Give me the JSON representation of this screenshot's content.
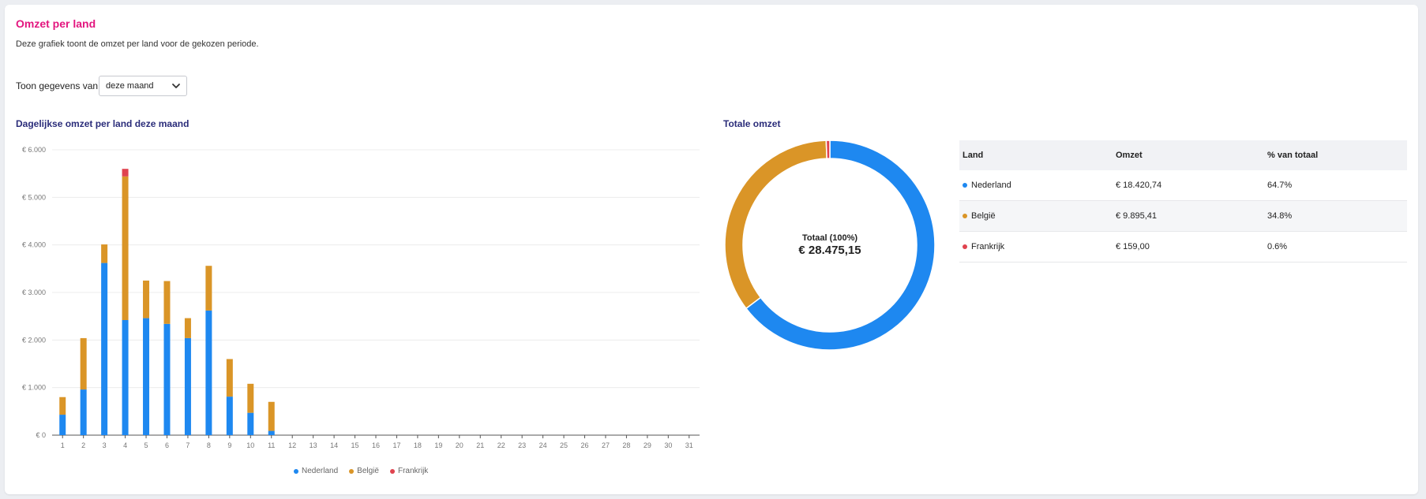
{
  "card": {
    "title": "Omzet per land",
    "description": "Deze grafiek toont de omzet per land voor de gekozen periode.",
    "filter_label": "Toon gegevens van:",
    "filter_value": "deze maand"
  },
  "bar_section_title": "Dagelijkse omzet per land deze maand",
  "donut_section_title": "Totale omzet",
  "donut": {
    "center_label": "Totaal (100%)",
    "center_value": "€ 28.475,15"
  },
  "table": {
    "headers": [
      "Land",
      "Omzet",
      "% van totaal"
    ],
    "rows": [
      {
        "country": "Nederland",
        "amount": "€ 18.420,74",
        "percent": "64.7%",
        "color": "#1e88f0"
      },
      {
        "country": "België",
        "amount": "€ 9.895,41",
        "percent": "34.8%",
        "color": "#da9527"
      },
      {
        "country": "Frankrijk",
        "amount": "€ 159,00",
        "percent": "0.6%",
        "color": "#e0434f"
      }
    ]
  },
  "colors": {
    "nederland": "#1e88f0",
    "belgie": "#da9527",
    "frankrijk": "#e0434f",
    "title": "#e3167f",
    "section_title": "#2b2d7a"
  },
  "chart_data": [
    {
      "type": "bar",
      "stacked": true,
      "title": "Dagelijkse omzet per land deze maand",
      "categories": [
        "1",
        "2",
        "3",
        "4",
        "5",
        "6",
        "7",
        "8",
        "9",
        "10",
        "11",
        "12",
        "13",
        "14",
        "15",
        "16",
        "17",
        "18",
        "19",
        "20",
        "21",
        "22",
        "23",
        "24",
        "25",
        "26",
        "27",
        "28",
        "29",
        "30",
        "31"
      ],
      "y_ticks": [
        "€ 0",
        "€ 1.000",
        "€ 2.000",
        "€ 3.000",
        "€ 4.000",
        "€ 5.000",
        "€ 6.000"
      ],
      "ylim": [
        0,
        6000
      ],
      "grid": true,
      "legend_position": "bottom",
      "series": [
        {
          "name": "Nederland",
          "color": "#1e88f0",
          "values": [
            430,
            960,
            3620,
            2420,
            2460,
            2340,
            2040,
            2620,
            810,
            470,
            90,
            0,
            0,
            0,
            0,
            0,
            0,
            0,
            0,
            0,
            0,
            0,
            0,
            0,
            0,
            0,
            0,
            0,
            0,
            0,
            0
          ]
        },
        {
          "name": "België",
          "color": "#da9527",
          "values": [
            370,
            1080,
            390,
            3020,
            790,
            900,
            420,
            940,
            790,
            610,
            610,
            0,
            0,
            0,
            0,
            0,
            0,
            0,
            0,
            0,
            0,
            0,
            0,
            0,
            0,
            0,
            0,
            0,
            0,
            0,
            0
          ]
        },
        {
          "name": "Frankrijk",
          "color": "#e0434f",
          "values": [
            0,
            0,
            0,
            159,
            0,
            0,
            0,
            0,
            0,
            0,
            0,
            0,
            0,
            0,
            0,
            0,
            0,
            0,
            0,
            0,
            0,
            0,
            0,
            0,
            0,
            0,
            0,
            0,
            0,
            0,
            0
          ]
        }
      ]
    },
    {
      "type": "pie",
      "donut": true,
      "title": "Totale omzet",
      "categories": [
        "Nederland",
        "België",
        "Frankrijk"
      ],
      "values": [
        18420.74,
        9895.41,
        159.0
      ],
      "colors": [
        "#1e88f0",
        "#da9527",
        "#e0434f"
      ]
    }
  ]
}
